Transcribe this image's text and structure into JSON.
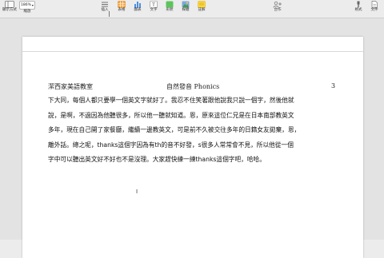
{
  "toolbar": {
    "view_label": "顯示方式",
    "zoom_value": "186%",
    "zoom_label": "縮放",
    "insert_label": "插入",
    "table_label": "表格",
    "chart_label": "圖表",
    "text_label": "文字",
    "shape_label": "形狀",
    "media_label": "媒體",
    "comment_label": "註解",
    "collaborate_label": "合作",
    "format_label": "格式",
    "document_label": "文件"
  },
  "document": {
    "header_left": "潔西家美語教室",
    "header_center": "自然發音 Phonics",
    "header_page": "3",
    "lines": [
      "下大同，每個人都只要學一個英文字就好了。我忍不住笑著跟他說我只說一個字，然後他就",
      "說，是啊，不過因為他聽很多，所以他一聽就知道。恩，原來這位仁兄是在日本南部教英文",
      "多年，現在自己開了家餐廳，繼續一邊教英文，可是前不久被交往多年的日籍女友拋棄，恩，",
      "離外話。總之呢，thanks這個字因為有th的音不好發，s很多人常常會不見，所以他從一個",
      "字中可以聽出英文好不好也不是沒理。大家趕快練一練thanks這個字吧，哈哈。"
    ]
  }
}
